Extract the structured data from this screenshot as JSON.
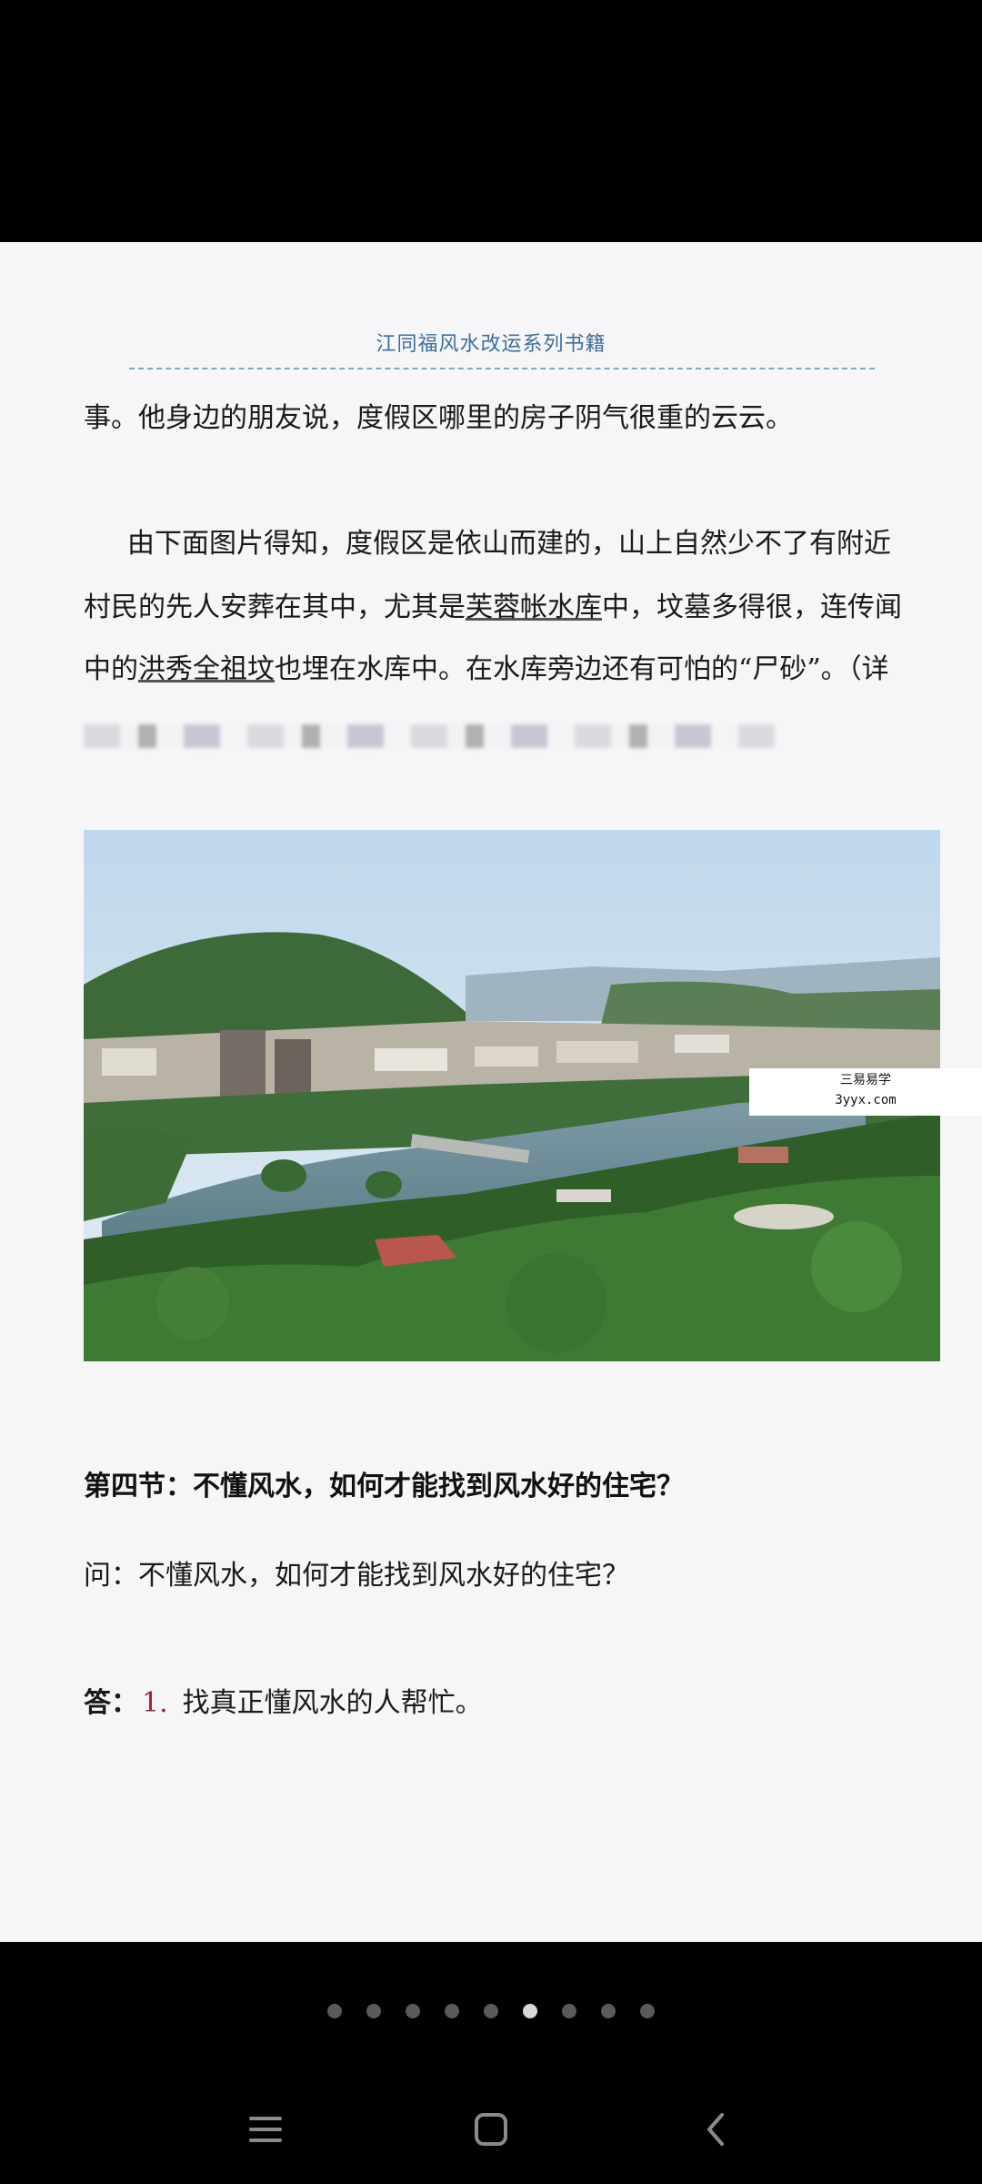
{
  "header": {
    "title": "江同福风水改运系列书籍"
  },
  "content": {
    "line1": "事。他身边的朋友说，度假区哪里的房子阴气很重的云云。",
    "para2_line1": "由下面图片得知，度假区是依山而建的，山上自然少不了有附近",
    "para2_line2_a": "村民的先人安葬在其中，尤其是",
    "para2_line2_link": "芙蓉帐水库",
    "para2_line2_b": "中，坟墓多得很，连传闻",
    "para2_line3_a": "中的",
    "para2_line3_link": "洪秀全祖坟",
    "para2_line3_b": "也埋在水库中。在水库旁边还有可怕的“尸砂”。（详"
  },
  "watermark": {
    "line1": "三易易学",
    "line2": "3yyx.com"
  },
  "section": {
    "heading": "第四节：不懂风水，如何才能找到风水好的住宅？",
    "question": "问：不懂风水，如何才能找到风水好的住宅？",
    "answer_label": "答：",
    "answer_number": "1.",
    "answer_text": "找真正懂风水的人帮忙。"
  },
  "pager": {
    "total": 9,
    "active_index": 5
  },
  "nav": {
    "icons": [
      "menu-icon",
      "home-icon",
      "back-icon"
    ]
  }
}
